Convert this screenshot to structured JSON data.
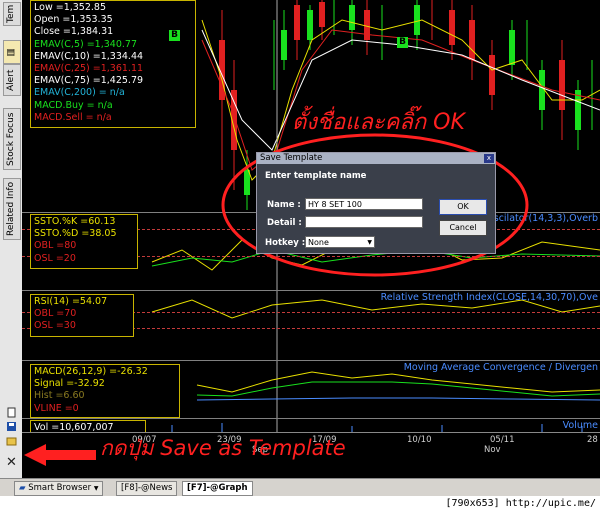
{
  "sidebar": {
    "tabs": [
      "Tem",
      "Alert",
      "Stock Focus",
      "Related Info"
    ],
    "icons": [
      "new-file-icon",
      "save-icon",
      "folder-icon",
      "close-icon"
    ]
  },
  "price_panel": {
    "lines": [
      {
        "text": "Low   =1,352.85",
        "color": "#ffffff"
      },
      {
        "text": "Open  =1,353.35",
        "color": "#ffffff"
      },
      {
        "text": "Close  =1,384.31",
        "color": "#ffffff"
      },
      {
        "text": "EMAV(C,5)   =1,340.77",
        "color": "#19e01e"
      },
      {
        "text": "EMAV(C,10)   =1,334.44",
        "color": "#ffffff"
      },
      {
        "text": "EMAV(C,25)   =1,361.11",
        "color": "#e02020"
      },
      {
        "text": "EMAV(C,75)   =1,425.79",
        "color": "#ffffff"
      },
      {
        "text": "EMAV(C,200)  = n/a",
        "color": "#22b2d6"
      },
      {
        "text": "MACD.Buy = n/a",
        "color": "#19e01e"
      },
      {
        "text": "MACD.Sell = n/a",
        "color": "#e02020"
      }
    ],
    "markers": [
      "B",
      "B"
    ]
  },
  "stochastic_panel": {
    "lines": [
      {
        "text": "SSTO.%K   =60.13",
        "color": "#e8e000"
      },
      {
        "text": "SSTO.%D   =38.05",
        "color": "#e8e000"
      },
      {
        "text": "OBL   =80",
        "color": "#e02020"
      },
      {
        "text": "OSL   =20",
        "color": "#e02020"
      }
    ],
    "title": "Oscilator(14,3,3),Overb"
  },
  "rsi_panel": {
    "lines": [
      {
        "text": "RSI(14)   =54.07",
        "color": "#e8e000"
      },
      {
        "text": "OBL   =70",
        "color": "#e02020"
      },
      {
        "text": "OSL   =30",
        "color": "#e02020"
      }
    ],
    "title": "Relative Strength Index(CLOSE,14,30,70),Ove"
  },
  "macd_panel": {
    "lines": [
      {
        "text": "MACD(26,12,9)   =-26.32",
        "color": "#e8e000"
      },
      {
        "text": "Signal   =-32.92",
        "color": "#e8e000"
      },
      {
        "text": "Hist   =6.60",
        "color": "#8a7a20"
      },
      {
        "text": "VLINE   =0",
        "color": "#e02020"
      }
    ],
    "title": "Moving Average Convergence / Divergen"
  },
  "volume_panel": {
    "label": "Vol   =10,607,007",
    "title": "Volume"
  },
  "x_axis": [
    "09/07",
    "23/09",
    "Sep",
    "17/09",
    "10/10",
    "05/11",
    "Nov",
    "28"
  ],
  "dialog": {
    "title": "Save Template",
    "heading": "Enter template name",
    "name_label": "Name :",
    "name_value": "HY 8 SET 100",
    "detail_label": "Detail :",
    "detail_value": "",
    "hotkey_label": "Hotkey :",
    "hotkey_value": "None",
    "ok_label": "OK",
    "cancel_label": "Cancel",
    "close_glyph": "x"
  },
  "annotations": {
    "top": "ตั้งชื่อและคลิ๊ก OK",
    "bottom": "กดปุ่ม Save as Template"
  },
  "bottom_tabs": [
    "Smart Browser",
    "[F8]-@News",
    "[F7]-@Graph"
  ],
  "footer": "[790x653] http://upic.me/",
  "colors": {
    "accent_red": "#ff2020",
    "panel_border": "#c8b400",
    "bull": "#19e01e",
    "bear": "#e02020"
  }
}
